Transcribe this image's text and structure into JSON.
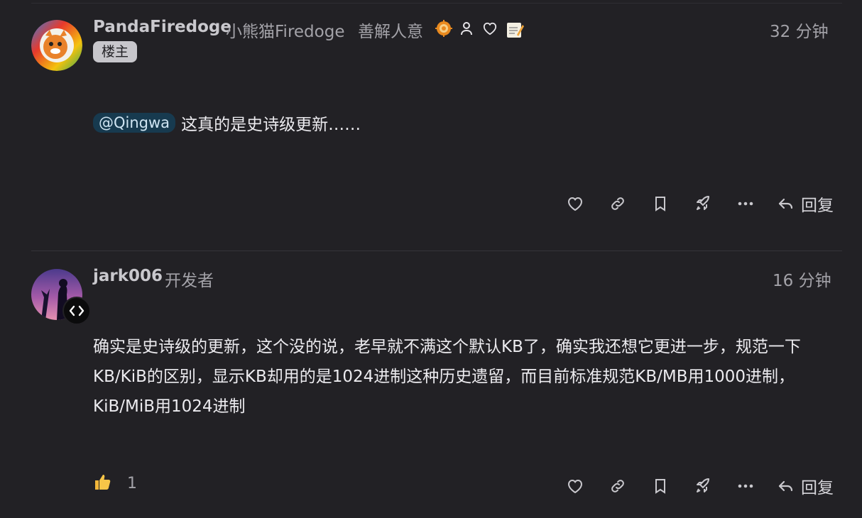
{
  "posts": [
    {
      "username": "PandaFiredoge",
      "display_name": "小熊猫Firedoge",
      "user_title": "善解人意",
      "time": "32 分钟",
      "tag": "楼主",
      "mention": "@Qingwa",
      "body": "这真的是史诗级更新……",
      "reply_label": "回复",
      "flair_icons": [
        "gear-icon",
        "user-icon",
        "heart-icon",
        "memo-icon"
      ]
    },
    {
      "username": "jark006",
      "user_title": "开发者",
      "time": "16 分钟",
      "body": "确实是史诗级的更新，这个没的说，老早就不满这个默认KB了，确实我还想它更进一步，规范一下KB/KiB的区别，显示KB却用的是1024进制这种历史遗留，而目前标准规范KB/MB用1000进制，KiB/MiB用1024进制",
      "reactions": {
        "icon": "thumbs-up-icon",
        "count": "1"
      },
      "reply_label": "回复"
    }
  ],
  "colors": {
    "background": "#222125",
    "text": "#ecebef",
    "muted": "#a3a2a8",
    "mention_bg": "#173a4f",
    "tag_bg": "#c7c6cb"
  }
}
